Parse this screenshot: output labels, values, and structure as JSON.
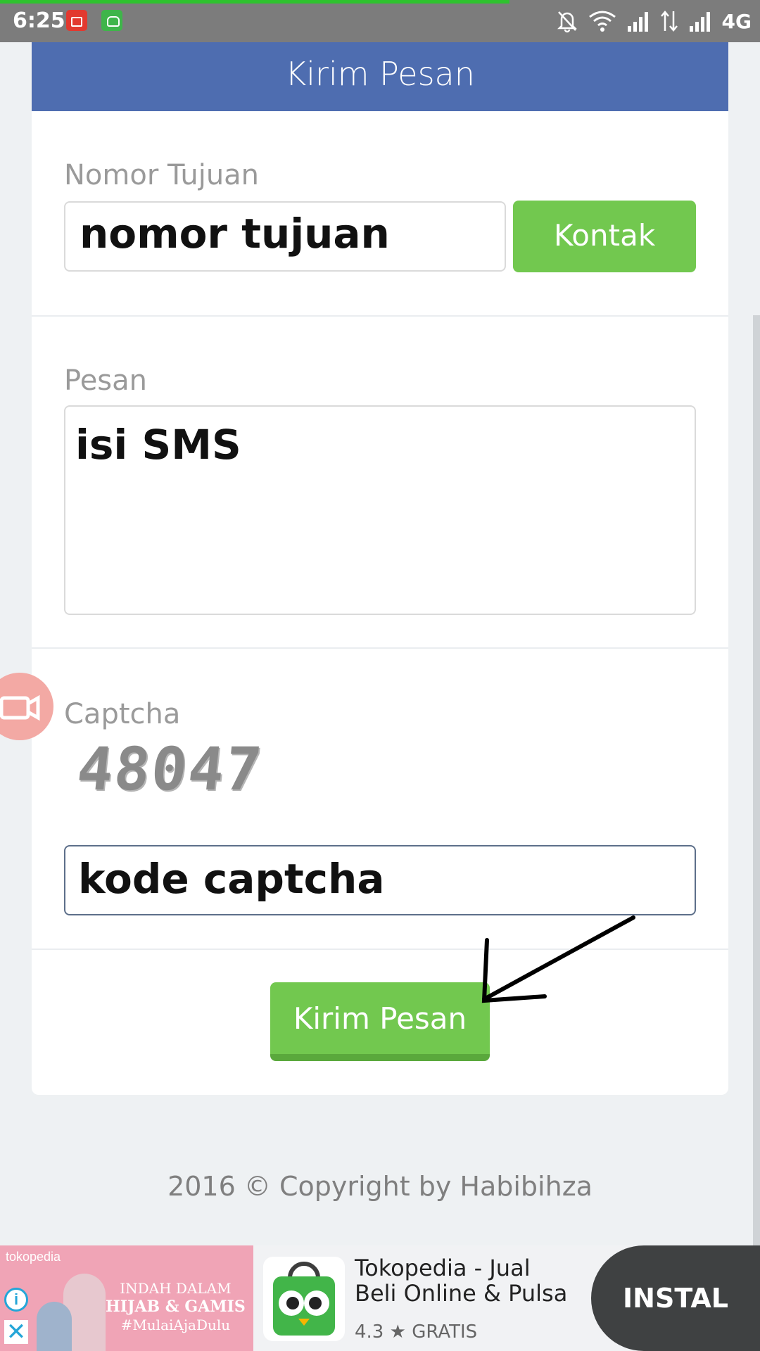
{
  "status_bar": {
    "time": "6:25",
    "network": "4G",
    "page_load_progress": 0.67
  },
  "form": {
    "header_title": "Kirim Pesan",
    "recipient": {
      "label": "Nomor Tujuan",
      "value": "nomor tujuan",
      "contact_button": "Kontak"
    },
    "message": {
      "label": "Pesan",
      "value": "isi SMS"
    },
    "captcha": {
      "label": "Captcha",
      "image_text": "48047",
      "input_value": "kode captcha"
    },
    "submit_label": "Kirim Pesan"
  },
  "footer": {
    "copyright": "2016 © Copyright by Habibihza"
  },
  "ad": {
    "image_brand": "tokopedia",
    "image_promo_line1": "INDAH DALAM",
    "image_promo_line2": "HIJAB & GAMIS",
    "image_promo_line3": "#MulaiAjaDulu",
    "title_line1": "Tokopedia - Jual",
    "title_line2": "Beli Online & Pulsa",
    "rating": "4.3",
    "price": "GRATIS",
    "install_label": "INSTAL"
  },
  "colors": {
    "header_blue": "#4e6db0",
    "button_green": "#72c84f",
    "status_bar": "#7c7c7c"
  }
}
